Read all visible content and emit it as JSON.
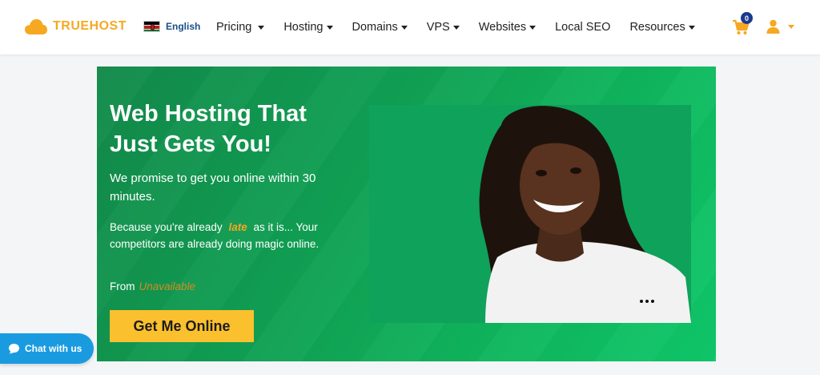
{
  "header": {
    "logo_text": "TRUEHOST",
    "language": "English",
    "nav": [
      {
        "label": "Pricing",
        "dropdown": true
      },
      {
        "label": "Hosting",
        "dropdown": true
      },
      {
        "label": "Domains",
        "dropdown": true
      },
      {
        "label": "VPS",
        "dropdown": true
      },
      {
        "label": "Websites",
        "dropdown": true
      },
      {
        "label": "Local SEO",
        "dropdown": false
      },
      {
        "label": "Resources",
        "dropdown": true
      }
    ],
    "cart_count": "0"
  },
  "hero": {
    "title": "Web Hosting That Just Gets You!",
    "subtitle": "We promise to get you online within 30 minutes.",
    "body_before": "Because you're already",
    "body_highlight": "late",
    "body_after": "as it is... Your competitors are already doing magic online.",
    "from_label": "From",
    "price_placeholder": "Unavailable",
    "cta_label": "Get Me Online"
  },
  "chat": {
    "label": "Chat with us"
  },
  "colors": {
    "brand_orange": "#f6a821",
    "hero_green": "#10a355",
    "cta_yellow": "#fbc02d",
    "chat_blue": "#1a9be0",
    "badge_navy": "#1a3a8f"
  },
  "icons": [
    "cloud-logo-icon",
    "kenya-flag-icon",
    "cart-icon",
    "user-icon",
    "chat-bubble-icon"
  ]
}
